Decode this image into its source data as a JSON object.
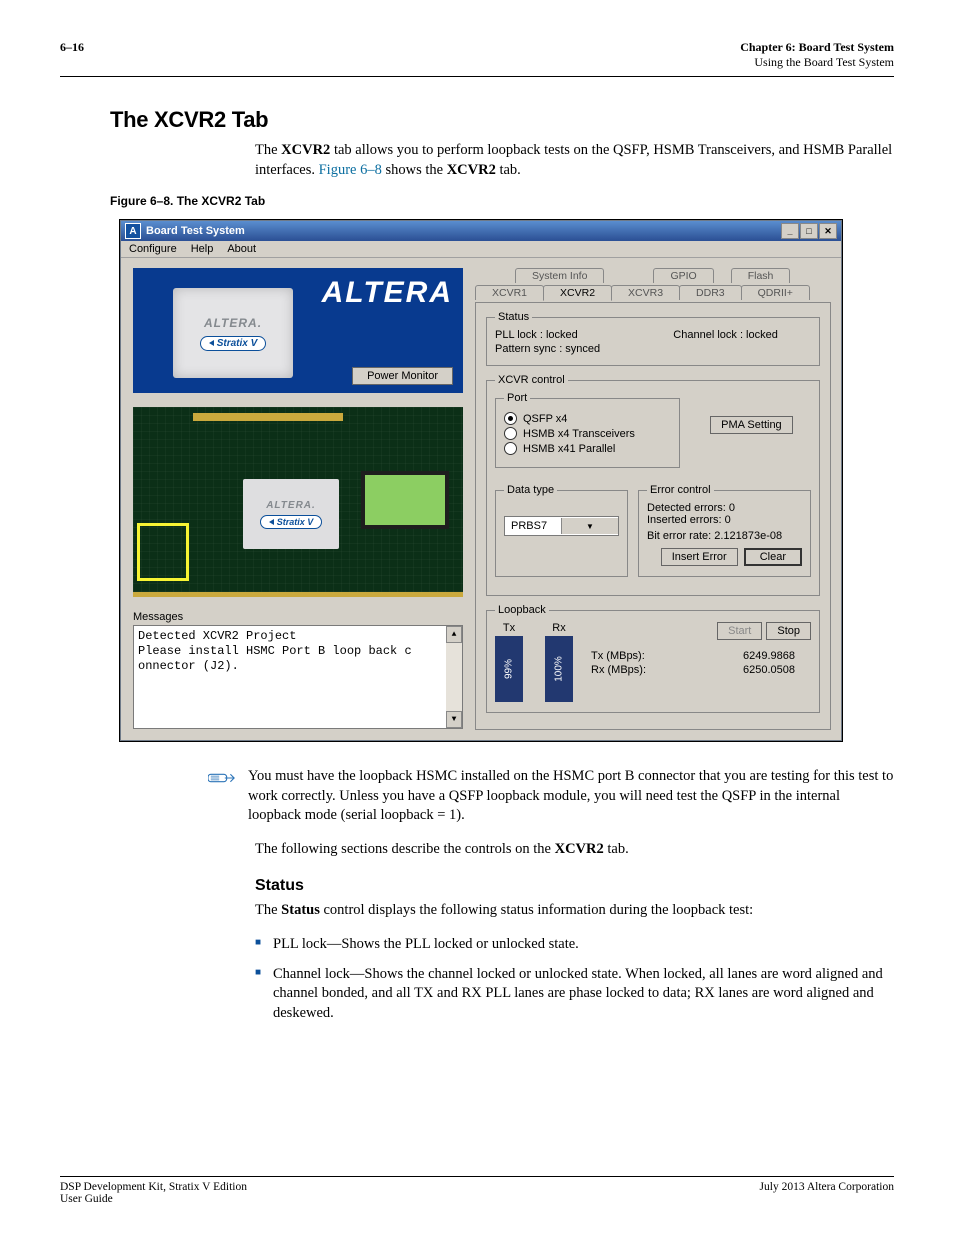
{
  "header": {
    "page_num": "6–16",
    "chapter": "Chapter 6:  Board Test System",
    "subtitle": "Using the Board Test System"
  },
  "section_title": "The XCVR2 Tab",
  "intro": {
    "p1_a": "The ",
    "p1_b": "XCVR2",
    "p1_c": " tab allows you to perform loopback tests on the QSFP, HSMB Transceivers, and HSMB Parallel interfaces. ",
    "p1_link": "Figure 6–8",
    "p1_d": " shows the ",
    "p1_e": "XCVR2",
    "p1_f": " tab."
  },
  "figure_caption": "Figure 6–8.  The XCVR2 Tab",
  "window": {
    "title": "Board Test System",
    "icon_letter": "A",
    "menus": [
      "Configure",
      "Help",
      "About"
    ],
    "win_btns": [
      "min",
      "max",
      "close"
    ]
  },
  "promo": {
    "altera_small": "ALTERA.",
    "stratix": "Stratix V",
    "altera_big": "ALTERA",
    "power_monitor": "Power Monitor"
  },
  "board": {
    "chip_logo": "ALTERA.",
    "chip_pill": "Stratix V"
  },
  "messages": {
    "label": "Messages",
    "line1": "Detected XCVR2 Project",
    "line2": "Please install HSMC Port B loop back c",
    "line3": "onnector (J2)."
  },
  "tabs_row1": [
    "System Info",
    "GPIO",
    "Flash"
  ],
  "tabs_row2": [
    "XCVR1",
    "XCVR2",
    "XCVR3",
    "DDR3",
    "QDRII+"
  ],
  "active_tab": "XCVR2",
  "status": {
    "legend": "Status",
    "pll": "PLL lock : locked",
    "channel": "Channel lock : locked",
    "pattern": "Pattern sync : synced"
  },
  "xcvr_control": {
    "legend": "XCVR control",
    "port_legend": "Port",
    "ports": [
      {
        "label": "QSFP x4",
        "selected": true
      },
      {
        "label": "HSMB x4 Transceivers",
        "selected": false
      },
      {
        "label": "HSMB x41 Parallel",
        "selected": false
      }
    ],
    "pma_btn": "PMA Setting",
    "data_type_legend": "Data type",
    "data_type_value": "PRBS7",
    "error_legend": "Error control",
    "detected": "Detected errors: 0",
    "inserted": "Inserted errors: 0",
    "ber": "Bit error rate: 2.121873e-08",
    "insert_btn": "Insert Error",
    "clear_btn": "Clear"
  },
  "loopback": {
    "legend": "Loopback",
    "tx_label": "Tx",
    "rx_label": "Rx",
    "tx_pct": "99%",
    "rx_pct": "100%",
    "start": "Start",
    "stop": "Stop",
    "tx_mbps_lbl": "Tx (MBps):",
    "tx_mbps": "6249.9868",
    "rx_mbps_lbl": "Rx (MBps):",
    "rx_mbps": "6250.0508"
  },
  "note": "You must have the loopback HSMC installed on the HSMC port B connector that you are testing for this test to work correctly. Unless you have a QSFP loopback module, you will need test the QSFP in the internal loopback mode (serial loopback = 1).",
  "post_note": {
    "a": "The following sections describe the controls on the ",
    "b": "XCVR2",
    "c": " tab."
  },
  "status_section": {
    "heading": "Status",
    "intro_a": "The ",
    "intro_b": "Status",
    "intro_c": " control displays the following status information during the loopback test:",
    "bullets": [
      {
        "term": "PLL lock",
        "desc": "—Shows the PLL locked or unlocked state."
      },
      {
        "term": "Channel lock",
        "desc": "—Shows the channel locked or unlocked state. When locked, all lanes are word aligned and channel bonded, and all TX and RX PLL lanes are phase locked to data; RX lanes are word aligned and deskewed."
      }
    ]
  },
  "footer": {
    "left1": "DSP Development Kit, Stratix V Edition",
    "left2": "User Guide",
    "right": "July 2013    Altera Corporation"
  }
}
